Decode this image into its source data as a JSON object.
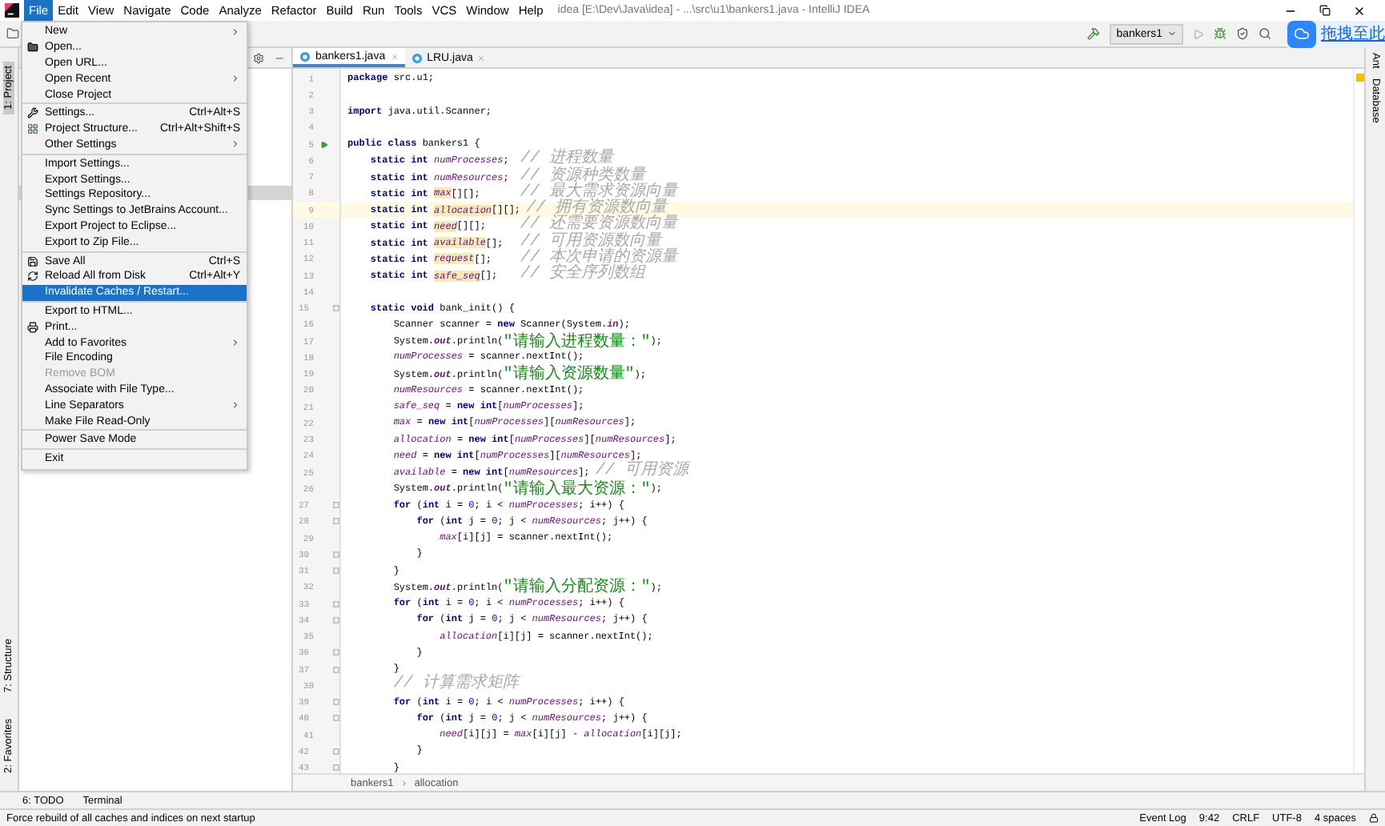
{
  "title_bar": {
    "menus": [
      {
        "label": "File",
        "selected": true
      },
      {
        "label": "Edit",
        "selected": false
      },
      {
        "label": "View",
        "selected": false
      },
      {
        "label": "Navigate",
        "selected": false
      },
      {
        "label": "Code",
        "selected": false
      },
      {
        "label": "Analyze",
        "selected": false
      },
      {
        "label": "Refactor",
        "selected": false
      },
      {
        "label": "Build",
        "selected": false
      },
      {
        "label": "Run",
        "selected": false
      },
      {
        "label": "Tools",
        "selected": false
      },
      {
        "label": "VCS",
        "selected": false
      },
      {
        "label": "Window",
        "selected": false
      },
      {
        "label": "Help",
        "selected": false
      }
    ],
    "title": "idea [E:\\Dev\\Java\\idea] - ...\\src\\u1\\bankers1.java - IntelliJ IDEA"
  },
  "toolbar": {
    "run_config": "bankers1",
    "upload_hint": "拖拽至此"
  },
  "file_menu": [
    {
      "kind": "item",
      "label": "New",
      "submenu": true
    },
    {
      "kind": "item",
      "label": "Open..."
    },
    {
      "kind": "item",
      "label": "Open URL..."
    },
    {
      "kind": "item",
      "label": "Open Recent",
      "submenu": true
    },
    {
      "kind": "item",
      "label": "Close Project"
    },
    {
      "kind": "separator"
    },
    {
      "kind": "item",
      "label": "Settings...",
      "shortcut": "Ctrl+Alt+S"
    },
    {
      "kind": "item",
      "label": "Project Structure...",
      "shortcut": "Ctrl+Alt+Shift+S"
    },
    {
      "kind": "item",
      "label": "Other Settings",
      "submenu": true
    },
    {
      "kind": "separator"
    },
    {
      "kind": "item",
      "label": "Import Settings..."
    },
    {
      "kind": "item",
      "label": "Export Settings..."
    },
    {
      "kind": "item",
      "label": "Settings Repository..."
    },
    {
      "kind": "item",
      "label": "Sync Settings to JetBrains Account..."
    },
    {
      "kind": "item",
      "label": "Export Project to Eclipse..."
    },
    {
      "kind": "item",
      "label": "Export to Zip File..."
    },
    {
      "kind": "separator"
    },
    {
      "kind": "item",
      "label": "Save All",
      "shortcut": "Ctrl+S"
    },
    {
      "kind": "item",
      "label": "Reload All from Disk",
      "shortcut": "Ctrl+Alt+Y"
    },
    {
      "kind": "item",
      "label": "Invalidate Caches / Restart...",
      "selected": true
    },
    {
      "kind": "separator"
    },
    {
      "kind": "item",
      "label": "Export to HTML..."
    },
    {
      "kind": "item",
      "label": "Print..."
    },
    {
      "kind": "item",
      "label": "Add to Favorites",
      "submenu": true
    },
    {
      "kind": "item",
      "label": "File Encoding"
    },
    {
      "kind": "item",
      "label": "Remove BOM",
      "disabled": true
    },
    {
      "kind": "item",
      "label": "Associate with File Type..."
    },
    {
      "kind": "item",
      "label": "Line Separators",
      "submenu": true
    },
    {
      "kind": "item",
      "label": "Make File Read-Only"
    },
    {
      "kind": "separator"
    },
    {
      "kind": "item",
      "label": "Power Save Mode"
    },
    {
      "kind": "separator"
    },
    {
      "kind": "item",
      "label": "Exit"
    }
  ],
  "left_strip": [
    "1: Project",
    "7: Structure",
    "2: Favorites"
  ],
  "right_strip": [
    "Ant",
    "Database"
  ],
  "editor": {
    "tabs": [
      {
        "label": "bankers1.java",
        "selected": true
      },
      {
        "label": "LRU.java",
        "selected": false
      }
    ],
    "lines": [
      {
        "number": "1",
        "kind": "plain",
        "current": false,
        "tokens": [
          {
            "text": "package",
            "kind": "kw"
          },
          {
            "text": " src.u1;",
            "kind": "p"
          }
        ]
      },
      {
        "number": "2",
        "kind": "plain",
        "current": false
      },
      {
        "number": "3",
        "kind": "plain",
        "current": false,
        "tokens": [
          {
            "text": "import",
            "kind": "kw"
          },
          {
            "text": " java.util.Scanner;",
            "kind": "p"
          }
        ]
      },
      {
        "number": "4",
        "kind": "plain",
        "current": false
      },
      {
        "number": "5",
        "kind": "run",
        "current": false,
        "tokens": [
          {
            "text": "public class",
            "kind": "kw"
          },
          {
            "text": " bankers1 {",
            "kind": "p"
          }
        ]
      },
      {
        "number": "6",
        "kind": "plain",
        "current": false,
        "tokens": [
          {
            "text": "    static int ",
            "kind": "kw"
          },
          {
            "text": "numProcesses",
            "kind": "f"
          },
          {
            "text": ";  ",
            "kind": "p"
          },
          {
            "text": "// 进程数量",
            "kind": "c"
          }
        ]
      },
      {
        "number": "7",
        "kind": "plain",
        "current": false,
        "tokens": [
          {
            "text": "    static int ",
            "kind": "kw"
          },
          {
            "text": "numResources",
            "kind": "f"
          },
          {
            "text": ";  ",
            "kind": "p"
          },
          {
            "text": "// 资源种类数量",
            "kind": "c"
          }
        ]
      },
      {
        "number": "8",
        "kind": "plain",
        "current": false,
        "tokens": [
          {
            "text": "    static int ",
            "kind": "kw"
          },
          {
            "text": "max",
            "kind": "h"
          },
          {
            "text": "[][];       ",
            "kind": "p"
          },
          {
            "text": "// 最大需求资源向量",
            "kind": "c"
          }
        ]
      },
      {
        "number": "9",
        "kind": "plain",
        "current": true,
        "tokens": [
          {
            "text": "    static int ",
            "kind": "kw"
          },
          {
            "text": "allocation",
            "kind": "h"
          },
          {
            "text": "[][]; ",
            "kind": "p"
          },
          {
            "text": "// 拥有资源数向量",
            "kind": "c"
          }
        ]
      },
      {
        "number": "10",
        "kind": "plain",
        "current": false,
        "tokens": [
          {
            "text": "    static int ",
            "kind": "kw"
          },
          {
            "text": "need",
            "kind": "h"
          },
          {
            "text": "[][];      ",
            "kind": "p"
          },
          {
            "text": "// 还需要资源数向量",
            "kind": "c"
          }
        ]
      },
      {
        "number": "11",
        "kind": "plain",
        "current": false,
        "tokens": [
          {
            "text": "    static int ",
            "kind": "kw"
          },
          {
            "text": "available",
            "kind": "h"
          },
          {
            "text": "[];   ",
            "kind": "p"
          },
          {
            "text": "// 可用资源数向量",
            "kind": "c"
          }
        ]
      },
      {
        "number": "12",
        "kind": "plain",
        "current": false,
        "tokens": [
          {
            "text": "    static int ",
            "kind": "kw"
          },
          {
            "text": "request",
            "kind": "h"
          },
          {
            "text": "[];     ",
            "kind": "p"
          },
          {
            "text": "// 本次申请的资源量",
            "kind": "c"
          }
        ]
      },
      {
        "number": "13",
        "kind": "plain",
        "current": false,
        "tokens": [
          {
            "text": "    static int ",
            "kind": "kw"
          },
          {
            "text": "safe_seq",
            "kind": "h"
          },
          {
            "text": "[];    ",
            "kind": "p"
          },
          {
            "text": "// 安全序列数组",
            "kind": "c"
          }
        ]
      },
      {
        "number": "14",
        "kind": "plain",
        "current": false
      },
      {
        "number": "15",
        "kind": "fold",
        "current": false,
        "tokens": [
          {
            "text": "    static void ",
            "kind": "kw"
          },
          {
            "text": "bank_init() {",
            "kind": "p"
          }
        ]
      },
      {
        "number": "16",
        "kind": "plain",
        "current": false,
        "tokens": [
          {
            "text": "        Scanner scanner = ",
            "kind": "p"
          },
          {
            "text": "new",
            "kind": "kw"
          },
          {
            "text": " Scanner(System.",
            "kind": "p"
          },
          {
            "text": "in",
            "kind": "o"
          },
          {
            "text": ");",
            "kind": "p"
          }
        ]
      },
      {
        "number": "17",
        "kind": "plain",
        "current": false,
        "tokens": [
          {
            "text": "        System.",
            "kind": "p"
          },
          {
            "text": "out",
            "kind": "o"
          },
          {
            "text": ".println(",
            "kind": "p"
          },
          {
            "text": "\"请输入进程数量：\"",
            "kind": "s"
          },
          {
            "text": ");",
            "kind": "p"
          }
        ]
      },
      {
        "number": "18",
        "kind": "plain",
        "current": false,
        "tokens": [
          {
            "text": "        numProcesses",
            "kind": "f"
          },
          {
            "text": " = scanner.nextInt();",
            "kind": "p"
          }
        ]
      },
      {
        "number": "19",
        "kind": "plain",
        "current": false,
        "tokens": [
          {
            "text": "        System.",
            "kind": "p"
          },
          {
            "text": "out",
            "kind": "o"
          },
          {
            "text": ".println(",
            "kind": "p"
          },
          {
            "text": "\"请输入资源数量\"",
            "kind": "s"
          },
          {
            "text": ");",
            "kind": "p"
          }
        ]
      },
      {
        "number": "20",
        "kind": "plain",
        "current": false,
        "tokens": [
          {
            "text": "        numResources",
            "kind": "f"
          },
          {
            "text": " = scanner.nextInt();",
            "kind": "p"
          }
        ]
      },
      {
        "number": "21",
        "kind": "plain",
        "current": false,
        "tokens": [
          {
            "text": "        safe_seq",
            "kind": "f"
          },
          {
            "text": " = ",
            "kind": "p"
          },
          {
            "text": "new int",
            "kind": "kw"
          },
          {
            "text": "[",
            "kind": "p"
          },
          {
            "text": "numProcesses",
            "kind": "f"
          },
          {
            "text": "];",
            "kind": "p"
          }
        ]
      },
      {
        "number": "22",
        "kind": "plain",
        "current": false,
        "tokens": [
          {
            "text": "        max",
            "kind": "f"
          },
          {
            "text": " = ",
            "kind": "p"
          },
          {
            "text": "new int",
            "kind": "kw"
          },
          {
            "text": "[",
            "kind": "p"
          },
          {
            "text": "numProcesses",
            "kind": "f"
          },
          {
            "text": "][",
            "kind": "p"
          },
          {
            "text": "numResources",
            "kind": "f"
          },
          {
            "text": "];",
            "kind": "p"
          }
        ]
      },
      {
        "number": "23",
        "kind": "plain",
        "current": false,
        "tokens": [
          {
            "text": "        allocation",
            "kind": "f"
          },
          {
            "text": " = ",
            "kind": "p"
          },
          {
            "text": "new int",
            "kind": "kw"
          },
          {
            "text": "[",
            "kind": "p"
          },
          {
            "text": "numProcesses",
            "kind": "f"
          },
          {
            "text": "][",
            "kind": "p"
          },
          {
            "text": "numResources",
            "kind": "f"
          },
          {
            "text": "];",
            "kind": "p"
          }
        ]
      },
      {
        "number": "24",
        "kind": "plain",
        "current": false,
        "tokens": [
          {
            "text": "        need",
            "kind": "f"
          },
          {
            "text": " = ",
            "kind": "p"
          },
          {
            "text": "new int",
            "kind": "kw"
          },
          {
            "text": "[",
            "kind": "p"
          },
          {
            "text": "numProcesses",
            "kind": "f"
          },
          {
            "text": "][",
            "kind": "p"
          },
          {
            "text": "numResources",
            "kind": "f"
          },
          {
            "text": "];",
            "kind": "p"
          }
        ]
      },
      {
        "number": "25",
        "kind": "plain",
        "current": false,
        "tokens": [
          {
            "text": "        available",
            "kind": "f"
          },
          {
            "text": " = ",
            "kind": "p"
          },
          {
            "text": "new int",
            "kind": "kw"
          },
          {
            "text": "[",
            "kind": "p"
          },
          {
            "text": "numResources",
            "kind": "f"
          },
          {
            "text": "]; ",
            "kind": "p"
          },
          {
            "text": "// 可用资源",
            "kind": "c"
          }
        ]
      },
      {
        "number": "26",
        "kind": "plain",
        "current": false,
        "tokens": [
          {
            "text": "        System.",
            "kind": "p"
          },
          {
            "text": "out",
            "kind": "o"
          },
          {
            "text": ".println(",
            "kind": "p"
          },
          {
            "text": "\"请输入最大资源：\"",
            "kind": "s"
          },
          {
            "text": ");",
            "kind": "p"
          }
        ]
      },
      {
        "number": "27",
        "kind": "fold",
        "current": false,
        "tokens": [
          {
            "text": "        for",
            "kind": "kw"
          },
          {
            "text": " (",
            "kind": "p"
          },
          {
            "text": "int",
            "kind": "kw"
          },
          {
            "text": " i = ",
            "kind": "p"
          },
          {
            "text": "0",
            "kind": "n"
          },
          {
            "text": "; i < ",
            "kind": "p"
          },
          {
            "text": "numProcesses",
            "kind": "f"
          },
          {
            "text": "; i++) {",
            "kind": "p"
          }
        ]
      },
      {
        "number": "28",
        "kind": "fold",
        "current": false,
        "tokens": [
          {
            "text": "            for",
            "kind": "kw"
          },
          {
            "text": " (",
            "kind": "p"
          },
          {
            "text": "int",
            "kind": "kw"
          },
          {
            "text": " j = ",
            "kind": "p"
          },
          {
            "text": "0",
            "kind": "n"
          },
          {
            "text": "; j < ",
            "kind": "p"
          },
          {
            "text": "numResources",
            "kind": "f"
          },
          {
            "text": "; j++) {",
            "kind": "p"
          }
        ]
      },
      {
        "number": "29",
        "kind": "plain",
        "current": false,
        "tokens": [
          {
            "text": "                max",
            "kind": "f"
          },
          {
            "text": "[i][j] = scanner.nextInt();",
            "kind": "p"
          }
        ]
      },
      {
        "number": "30",
        "kind": "fold",
        "current": false,
        "tokens": [
          {
            "text": "            }",
            "kind": "p"
          }
        ]
      },
      {
        "number": "31",
        "kind": "fold",
        "current": false,
        "tokens": [
          {
            "text": "        }",
            "kind": "p"
          }
        ]
      },
      {
        "number": "32",
        "kind": "plain",
        "current": false,
        "tokens": [
          {
            "text": "        System.",
            "kind": "p"
          },
          {
            "text": "out",
            "kind": "o"
          },
          {
            "text": ".println(",
            "kind": "p"
          },
          {
            "text": "\"请输入分配资源：\"",
            "kind": "s"
          },
          {
            "text": ");",
            "kind": "p"
          }
        ]
      },
      {
        "number": "33",
        "kind": "fold",
        "current": false,
        "tokens": [
          {
            "text": "        for",
            "kind": "kw"
          },
          {
            "text": " (",
            "kind": "p"
          },
          {
            "text": "int",
            "kind": "kw"
          },
          {
            "text": " i = ",
            "kind": "p"
          },
          {
            "text": "0",
            "kind": "n"
          },
          {
            "text": "; i < ",
            "kind": "p"
          },
          {
            "text": "numProcesses",
            "kind": "f"
          },
          {
            "text": "; i++) {",
            "kind": "p"
          }
        ]
      },
      {
        "number": "34",
        "kind": "fold",
        "current": false,
        "tokens": [
          {
            "text": "            for",
            "kind": "kw"
          },
          {
            "text": " (",
            "kind": "p"
          },
          {
            "text": "int",
            "kind": "kw"
          },
          {
            "text": " j = ",
            "kind": "p"
          },
          {
            "text": "0",
            "kind": "n"
          },
          {
            "text": "; j < ",
            "kind": "p"
          },
          {
            "text": "numResources",
            "kind": "f"
          },
          {
            "text": "; j++) {",
            "kind": "p"
          }
        ]
      },
      {
        "number": "35",
        "kind": "plain",
        "current": false,
        "tokens": [
          {
            "text": "                allocation",
            "kind": "f"
          },
          {
            "text": "[i][j] = scanner.nextInt();",
            "kind": "p"
          }
        ]
      },
      {
        "number": "36",
        "kind": "fold",
        "current": false,
        "tokens": [
          {
            "text": "            }",
            "kind": "p"
          }
        ]
      },
      {
        "number": "37",
        "kind": "fold",
        "current": false,
        "tokens": [
          {
            "text": "        }",
            "kind": "p"
          }
        ]
      },
      {
        "number": "38",
        "kind": "plain",
        "current": false,
        "tokens": [
          {
            "text": "        // 计算需求矩阵",
            "kind": "c"
          }
        ]
      },
      {
        "number": "39",
        "kind": "fold",
        "current": false,
        "tokens": [
          {
            "text": "        for",
            "kind": "kw"
          },
          {
            "text": " (",
            "kind": "p"
          },
          {
            "text": "int",
            "kind": "kw"
          },
          {
            "text": " i = ",
            "kind": "p"
          },
          {
            "text": "0",
            "kind": "n"
          },
          {
            "text": "; i < ",
            "kind": "p"
          },
          {
            "text": "numProcesses",
            "kind": "f"
          },
          {
            "text": "; i++) {",
            "kind": "p"
          }
        ]
      },
      {
        "number": "40",
        "kind": "fold",
        "current": false,
        "tokens": [
          {
            "text": "            for",
            "kind": "kw"
          },
          {
            "text": " (",
            "kind": "p"
          },
          {
            "text": "int",
            "kind": "kw"
          },
          {
            "text": " j = ",
            "kind": "p"
          },
          {
            "text": "0",
            "kind": "n"
          },
          {
            "text": "; j < ",
            "kind": "p"
          },
          {
            "text": "numResources",
            "kind": "f"
          },
          {
            "text": "; j++) {",
            "kind": "p"
          }
        ]
      },
      {
        "number": "41",
        "kind": "plain",
        "current": false,
        "tokens": [
          {
            "text": "                need",
            "kind": "f"
          },
          {
            "text": "[i][j] = ",
            "kind": "p"
          },
          {
            "text": "max",
            "kind": "f"
          },
          {
            "text": "[i][j] - ",
            "kind": "p"
          },
          {
            "text": "allocation",
            "kind": "f"
          },
          {
            "text": "[i][j];",
            "kind": "p"
          }
        ]
      },
      {
        "number": "42",
        "kind": "fold",
        "current": false,
        "tokens": [
          {
            "text": "            }",
            "kind": "p"
          }
        ]
      },
      {
        "number": "43",
        "kind": "fold",
        "current": false,
        "tokens": [
          {
            "text": "        }",
            "kind": "p"
          }
        ]
      }
    ],
    "breadcrumbs": [
      "bankers1",
      "allocation"
    ]
  },
  "tool_windows": [
    "6: TODO",
    "Terminal"
  ],
  "status_bar": {
    "message": "Force rebuild of all caches and indices on next startup",
    "items": [
      "9:42",
      "CRLF",
      "UTF-8",
      "4 spaces"
    ],
    "event_log": "Event Log"
  }
}
